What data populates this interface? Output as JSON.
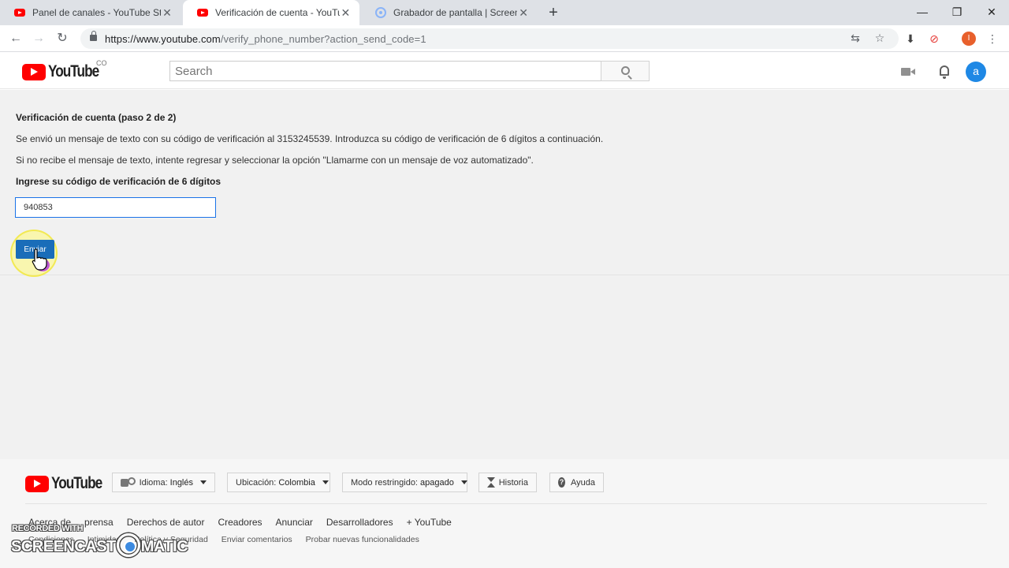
{
  "browser": {
    "tabs": [
      {
        "title": "Panel de canales - YouTube Studio",
        "active": false,
        "favicon": "youtube-favicon"
      },
      {
        "title": "Verificación de cuenta - YouTube",
        "active": true,
        "favicon": "youtube-favicon"
      },
      {
        "title": "Grabador de pantalla | Screencast-O-Matic",
        "active": false,
        "favicon": "screencast-favicon"
      }
    ],
    "new_tab_label": "+",
    "window_controls": {
      "minimize": "—",
      "maximize": "❐",
      "close": "✕"
    },
    "url_host": "https://www.youtube.com",
    "url_path": "/verify_phone_number?action_send_code=1",
    "profile_initial": "I"
  },
  "header": {
    "logo_text": "YouTube",
    "country_code": "CO",
    "search_placeholder": "Search",
    "avatar_initial": "a"
  },
  "main": {
    "title": "Verificación de cuenta (paso 2 de 2)",
    "message": "Se envió un mensaje de texto con su código de verificación al 3153245539. Introduzca su código de verificación de 6 dígitos a continuación.",
    "fallback": "Si no recibe el mensaje de texto, intente regresar y seleccionar la opción \"Llamarme con un mensaje de voz automatizado\".",
    "code_label": "Ingrese su código de verificación de 6 dígitos",
    "code_value": "940853",
    "submit_label": "Enviar"
  },
  "footer": {
    "logo_text": "YouTube",
    "language_label": "Idioma:",
    "language_value": "Inglés",
    "location_label": "Ubicación:",
    "location_value": "Colombia",
    "restricted_label": "Modo restringido:",
    "restricted_value": "apagado",
    "history_label": "Historia",
    "help_label": "Ayuda",
    "links_primary": [
      "Acerca de",
      "prensa",
      "Derechos de autor",
      "Creadores",
      "Anunciar",
      "Desarrolladores",
      "+ YouTube"
    ],
    "links_secondary": [
      "Condiciones",
      "Intimidad",
      "Política y Seguridad",
      "Enviar comentarios",
      "Probar nuevas funcionalidades"
    ]
  },
  "watermark": {
    "line1": "RECORDED WITH",
    "line2_left": "SCREENCAST",
    "line2_right": "MATIC"
  },
  "colors": {
    "youtube_red": "#ff0000",
    "submit_blue": "#1a6db9",
    "input_focus": "#1a73e8",
    "avatar_blue": "#1e88e5"
  }
}
